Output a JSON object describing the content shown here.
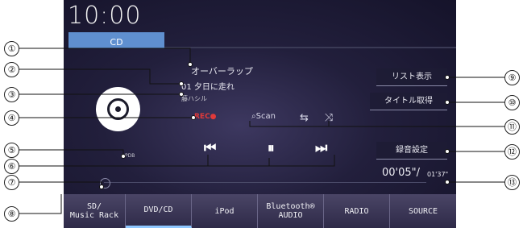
{
  "status": {
    "clock": "10:00",
    "source_tab": "CD"
  },
  "track": {
    "title": "オーバーラップ",
    "track_line": "01 夕日に走れ",
    "artist": "藤ハシル",
    "rec": "REC●"
  },
  "controls": {
    "scan": "Scan",
    "prev": "⏮",
    "pause": "⏸",
    "next": "⏭",
    "repeat": "⇆",
    "shuffle": "⤨"
  },
  "right_buttons": {
    "list": "リスト表示",
    "title_fetch": "タイトル取得",
    "rec_settings": "録音設定"
  },
  "db_label": "PDB",
  "time": {
    "elapsed": "00'05\"",
    "sep": "/",
    "total": "01'37\""
  },
  "tabs": [
    {
      "line1": "SD/",
      "line2": "Music Rack"
    },
    {
      "line1": "DVD/CD",
      "line2": ""
    },
    {
      "line1": "iPod",
      "line2": ""
    },
    {
      "line1": "Bluetooth®",
      "line2": "AUDIO"
    },
    {
      "line1": "RADIO",
      "line2": ""
    },
    {
      "line1": "SOURCE",
      "line2": ""
    }
  ],
  "callouts": [
    "①",
    "②",
    "③",
    "④",
    "⑤",
    "⑥",
    "⑦",
    "⑧",
    "⑨",
    "⑩",
    "⑪",
    "⑫",
    "⑬"
  ]
}
